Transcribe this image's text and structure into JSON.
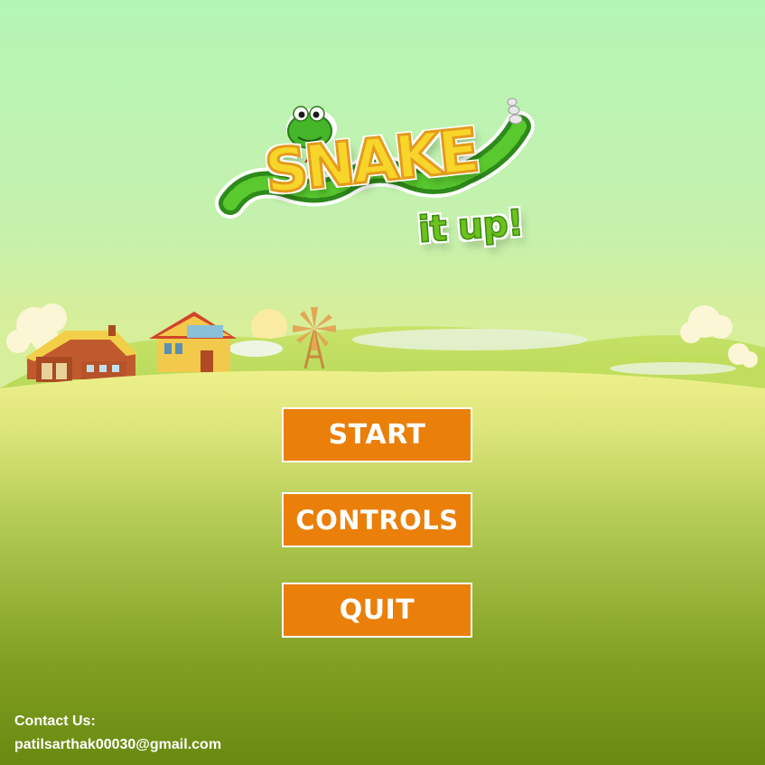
{
  "game": {
    "logo_word": "SNAKE",
    "logo_sub": "it up!"
  },
  "menu": {
    "start_label": "START",
    "controls_label": "CONTROLS",
    "quit_label": "QUIT"
  },
  "contact": {
    "heading": "Contact Us:",
    "email": "patilsarthak00030@gmail.com"
  },
  "colors": {
    "sky": "#b4f5b6",
    "button": "#ea7f0a",
    "logo_yellow": "#f7d52a",
    "snake_green": "#4fbf2c",
    "grass_dark": "#6c8a12"
  }
}
